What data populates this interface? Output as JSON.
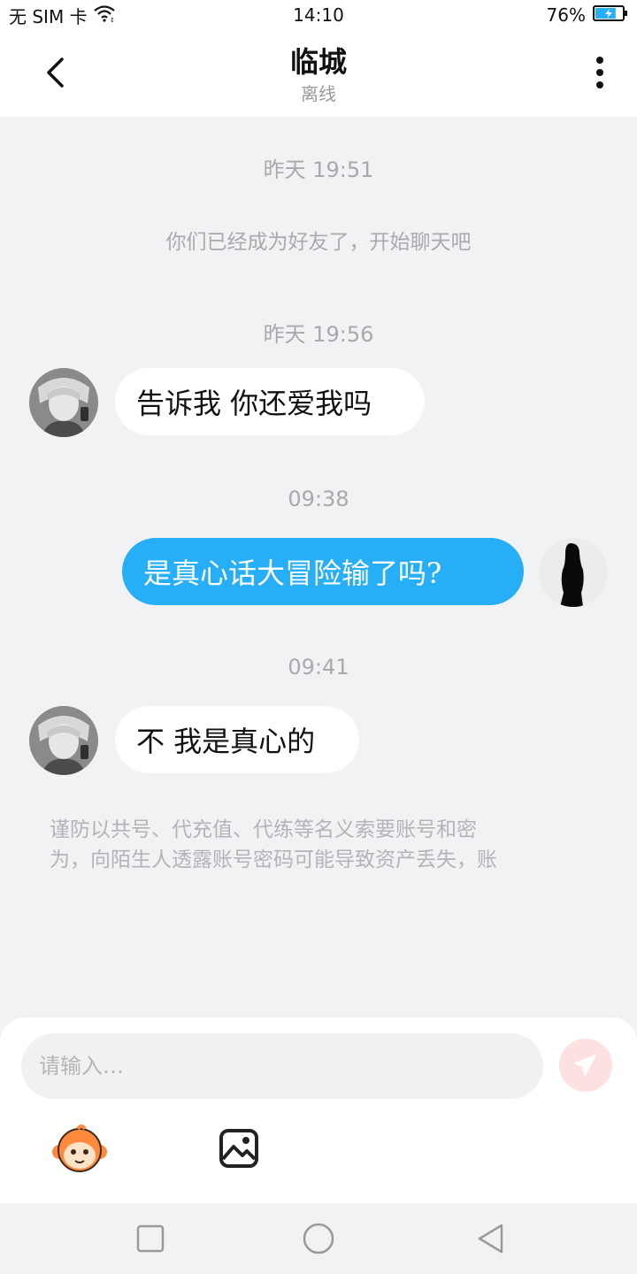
{
  "status_bar": {
    "carrier": "无 SIM 卡",
    "time": "14:10",
    "battery": "76%",
    "battery_level": 0.76
  },
  "header": {
    "title": "临城",
    "subtitle": "离线"
  },
  "messages": [
    {
      "type": "timestamp",
      "text": "昨天 19:51"
    },
    {
      "type": "system",
      "text": "你们已经成为好友了，开始聊天吧"
    },
    {
      "type": "timestamp",
      "text": "昨天 19:56"
    },
    {
      "type": "incoming",
      "text": "告诉我 你还爱我吗"
    },
    {
      "type": "timestamp",
      "text": "09:38"
    },
    {
      "type": "outgoing",
      "text": "是真心话大冒险输了吗?"
    },
    {
      "type": "timestamp",
      "text": "09:41"
    },
    {
      "type": "incoming",
      "text": "不 我是真心的"
    }
  ],
  "warning": {
    "line1": "谨防以共号、代充值、代练等名义索要账号和密",
    "line2": "为，向陌生人透露账号密码可能导致资产丢失，账"
  },
  "input": {
    "placeholder": "请输入…"
  },
  "colors": {
    "outgoing_bubble": "#26aef6",
    "chat_background": "#f1f2f4",
    "send_button": "#fde0e0"
  }
}
